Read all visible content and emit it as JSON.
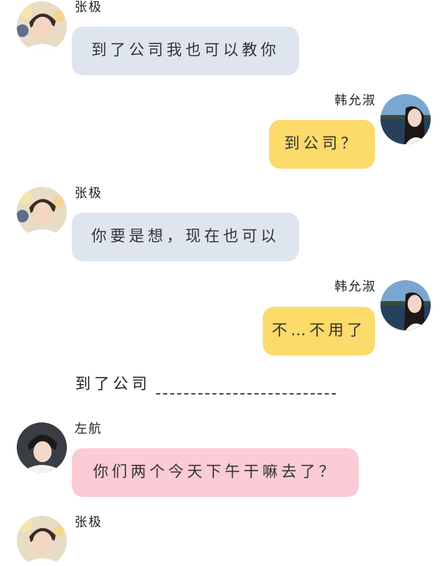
{
  "messages": [
    {
      "sender": "张极",
      "text": "到了公司我也可以教你",
      "side": "left",
      "color": "#dfe5ee",
      "avatar": "avatar-zhangji"
    },
    {
      "sender": "韩允淑",
      "text": "到公司？",
      "side": "right",
      "color": "#fddb6a",
      "avatar": "avatar-hanyunshu"
    },
    {
      "sender": "张极",
      "text": "你要是想，现在也可以",
      "side": "left",
      "color": "#dfe5ee",
      "avatar": "avatar-zhangji"
    },
    {
      "sender": "韩允淑",
      "text": "不…不用了",
      "side": "right",
      "color": "#fddb6a",
      "avatar": "avatar-hanyunshu"
    },
    {
      "sender": "左航",
      "text": "你们两个今天下午干嘛去了？",
      "side": "left",
      "color": "#fbcbd6",
      "avatar": "avatar-zuohang"
    },
    {
      "sender": "张极",
      "text": "",
      "side": "left",
      "color": "#dfe5ee",
      "avatar": "avatar-zhangji"
    }
  ],
  "narration": {
    "text": "到了公司"
  }
}
